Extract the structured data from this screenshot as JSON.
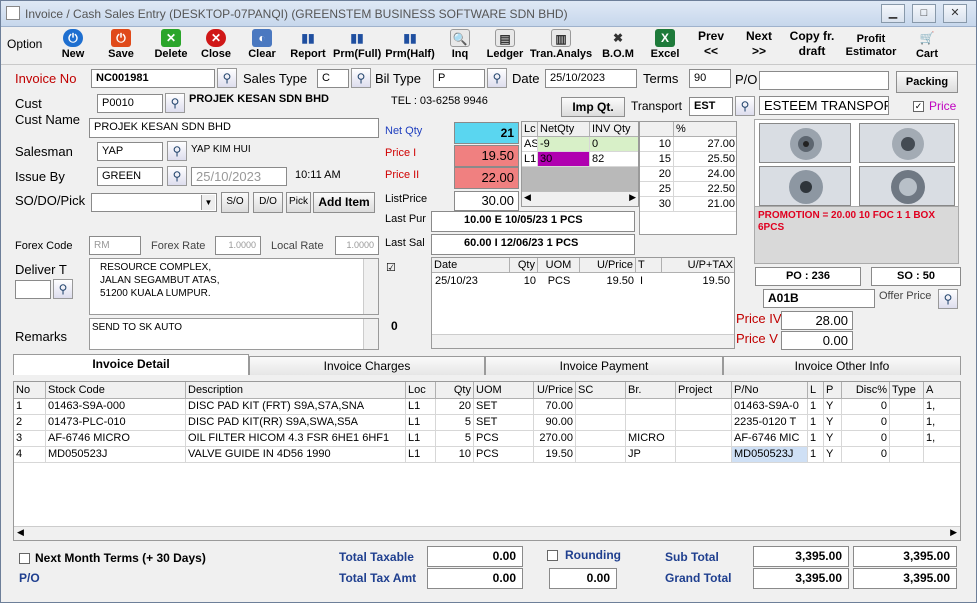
{
  "window": {
    "title": "Invoice / Cash Sales Entry    (DESKTOP-07PANQI)    (GREENSTEM BUSINESS SOFTWARE SDN BHD)",
    "minimize": "▁",
    "maximize": "□",
    "close": "✕"
  },
  "toolbar": {
    "option": "Option",
    "new": "New",
    "save": "Save",
    "delete": "Delete",
    "close": "Close",
    "clear": "Clear",
    "report": "Report",
    "prm_full": "Prm(Full)",
    "prm_half": "Prm(Half)",
    "inq": "Inq",
    "ledger": "Ledger",
    "tran_analys": "Tran.Analys",
    "bom": "B.O.M",
    "excel": "Excel",
    "prev": "Prev",
    "prev_arrow": "<<",
    "next": "Next",
    "next_arrow": ">>",
    "copy_fr": "Copy fr.",
    "draft": "draft",
    "profit": "Profit",
    "estimator": "Estimator",
    "cart": "Cart"
  },
  "header": {
    "invoice_no_label": "Invoice No",
    "invoice_no": "NC001981",
    "sales_type_label": "Sales Type",
    "sales_type": "C",
    "bil_type_label": "Bil Type",
    "bil_type": "P",
    "date_label": "Date",
    "date": "25/10/2023",
    "terms_label": "Terms",
    "terms": "90",
    "po_label": "P/O",
    "packing": "Packing",
    "cust_label": "Cust",
    "cust": "P0010",
    "cust_company": "PROJEK KESAN SDN BHD",
    "tel": "TEL : 03-6258 9946",
    "imp_qt": "Imp Qt.",
    "transport_label": "Transport",
    "transport": "EST",
    "transport_name": "ESTEEM TRANSPOR",
    "price_check": "Price",
    "cust_name_label": "Cust Name",
    "cust_name": "PROJEK KESAN SDN BHD",
    "salesman_label": "Salesman",
    "salesman": "YAP",
    "salesman_name": "YAP KIM HUI",
    "issue_by_label": "Issue By",
    "issue_by": "GREEN",
    "issue_date": "25/10/2023",
    "issue_time": "10:11 AM",
    "so_do_pick_label": "SO/DO/Pick",
    "so_btn": "S/O",
    "do_btn": "D/O",
    "pick_btn": "Pick",
    "add_item": "Add Item",
    "forex_code_label": "Forex Code",
    "forex_code": "RM",
    "forex_rate_label": "Forex Rate",
    "forex_rate": "1.0000",
    "local_rate_label": "Local Rate",
    "local_rate": "1.0000",
    "deliver_label": "Deliver T",
    "deliver_address": [
      "RESOURCE COMPLEX,",
      "JALAN SEGAMBUT ATAS,",
      "51200 KUALA LUMPUR."
    ],
    "remarks_label": "Remarks",
    "remarks": "SEND TO SK AUTO",
    "remarks_num": "0"
  },
  "pricing": {
    "net_qty_label": "Net Qty",
    "net_qty": "21",
    "price1_label": "Price I",
    "price1": "19.50",
    "price2_label": "Price II",
    "price2": "22.00",
    "listprice_label": "ListPrice",
    "listprice": "30.00",
    "last_pur_label": "Last Pur",
    "last_pur": "10.00  E   10/05/23  1  PCS",
    "last_sal_label": "Last Sal",
    "last_sal": "60.00  I   12/06/23  1  PCS",
    "loc_grid": {
      "headers": [
        "Lc",
        "NetQty",
        "INV Qty"
      ],
      "rows": [
        [
          "AS",
          "-9",
          "0"
        ],
        [
          "L1",
          "30",
          "82"
        ]
      ]
    },
    "qty_grid": {
      "headers": [
        "",
        "%"
      ],
      "rows": [
        [
          "10",
          "27.00"
        ],
        [
          "15",
          "25.50"
        ],
        [
          "20",
          "24.00"
        ],
        [
          "25",
          "22.50"
        ],
        [
          "30",
          "21.00"
        ]
      ]
    }
  },
  "history": {
    "headers": [
      "Date",
      "Qty",
      "UOM",
      "U/Price",
      "T",
      "U/P+TAX"
    ],
    "rows": [
      [
        "25/10/23",
        "10",
        "PCS",
        "19.50",
        "I",
        "19.50"
      ]
    ]
  },
  "promo": {
    "text": "PROMOTION = 20.00  10 FOC 1 1 BOX 6PCS",
    "po_label": "PO :",
    "po": "236",
    "so_label": "SO :",
    "so": "50",
    "location": "A01B",
    "offer_price": "Offer Price",
    "price4_label": "Price IV",
    "price4": "28.00",
    "price5_label": "Price V",
    "price5": "0.00"
  },
  "tabs": [
    "Invoice Detail",
    "Invoice Charges",
    "Invoice Payment",
    "Invoice Other Info"
  ],
  "detail": {
    "headers": [
      "No",
      "Stock Code",
      "Description",
      "Loc",
      "Qty",
      "UOM",
      "U/Price",
      "SC",
      "Br.",
      "Project",
      "P/No",
      "L",
      "P",
      "Disc%",
      "Type",
      "A"
    ],
    "rows": [
      [
        "1",
        "01463-S9A-000",
        "DISC PAD KIT (FRT) S9A,S7A,SNA",
        "L1",
        "20",
        "SET",
        "70.00",
        "",
        "",
        "",
        "01463-S9A-0",
        "1",
        "Y",
        "0",
        "",
        "1,"
      ],
      [
        "2",
        "01473-PLC-010",
        "DISC PAD KIT(RR) S9A,SWA,S5A",
        "L1",
        "5",
        "SET",
        "90.00",
        "",
        "",
        "",
        "2235-0120 T",
        "1",
        "Y",
        "0",
        "",
        "1,"
      ],
      [
        "3",
        "AF-6746 MICRO",
        "OIL FILTER HICOM 4.3  FSR 6HE1 6HF1",
        "L1",
        "5",
        "PCS",
        "270.00",
        "",
        "MICRO",
        "",
        "AF-6746 MIC",
        "1",
        "Y",
        "0",
        "",
        "1,"
      ],
      [
        "4",
        "MD050523J",
        "VALVE GUIDE IN  4D56 1990",
        "L1",
        "10",
        "PCS",
        "19.50",
        "",
        "JP",
        "",
        "MD050523J",
        "1",
        "Y",
        "0",
        "",
        ""
      ]
    ]
  },
  "footer": {
    "next_month": "Next Month Terms (+ 30 Days)",
    "po": "P/O",
    "total_taxable_label": "Total Taxable",
    "total_taxable": "0.00",
    "total_tax_label": "Total Tax Amt",
    "total_tax": "0.00",
    "rounding_label": "Rounding",
    "rounding": "0.00",
    "sub_total_label": "Sub Total",
    "sub_total": "3,395.00",
    "sub_total2": "3,395.00",
    "grand_total_label": "Grand Total",
    "grand_total": "3,395.00",
    "grand_total2": "3,395.00"
  },
  "colors": {
    "net_qty_bg": "#5ad6f0",
    "price_bg": "#f08080",
    "promo_text": "#e00020",
    "total_label": "#1f3f8f",
    "magenta": "#b000b0"
  }
}
